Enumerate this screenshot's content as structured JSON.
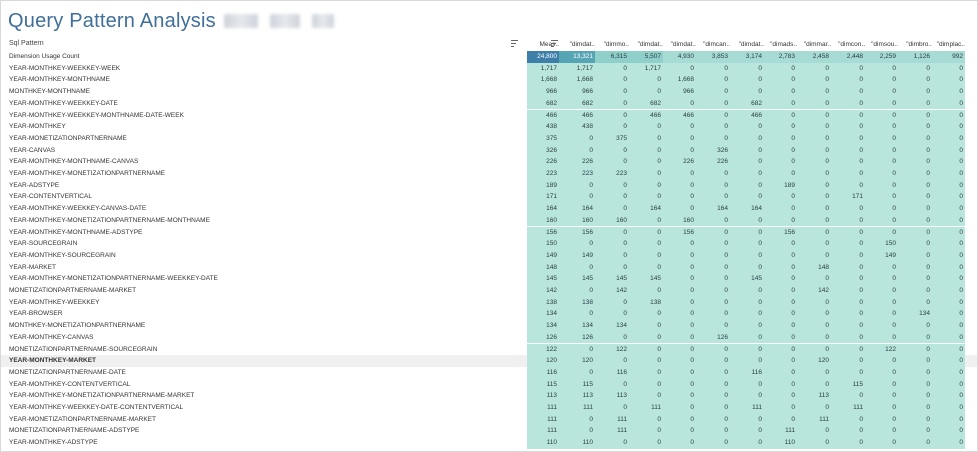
{
  "title": "Query Pattern Analysis",
  "row_header": "Sql Pattern",
  "columns": [
    "Meas..",
    "\"dimdat..",
    "\"dimmo..",
    "\"dimdat..",
    "\"dimdat..",
    "\"dimcan..",
    "\"dimdat..",
    "\"dimads..",
    "\"dimmar..",
    "\"dimcon..",
    "\"dimsou..",
    "\"dimbro..",
    "\"dimplac.."
  ],
  "colors": {
    "title": "#3f6f9a",
    "cell_base": "#b8e6dd",
    "cell_top_dark": "#3d7fa8",
    "cell_top_mid": "#56a5b5"
  },
  "rows": [
    {
      "label": "Dimension Usage Count",
      "values": [
        "24,800",
        "13,321",
        "6,315",
        "5,507",
        "4,930",
        "3,853",
        "3,174",
        "2,783",
        "2,458",
        "2,448",
        "2,259",
        "1,126",
        "992"
      ]
    },
    {
      "label": "YEAR-MONTHKEY-WEEKKEY-WEEK",
      "values": [
        "1,717",
        "1,717",
        "0",
        "1,717",
        "0",
        "0",
        "0",
        "0",
        "0",
        "0",
        "0",
        "0",
        "0"
      ]
    },
    {
      "label": "YEAR-MONTHKEY-MONTHNAME",
      "values": [
        "1,668",
        "1,668",
        "0",
        "0",
        "1,668",
        "0",
        "0",
        "0",
        "0",
        "0",
        "0",
        "0",
        "0"
      ]
    },
    {
      "label": "MONTHKEY-MONTHNAME",
      "values": [
        "966",
        "966",
        "0",
        "0",
        "966",
        "0",
        "0",
        "0",
        "0",
        "0",
        "0",
        "0",
        "0"
      ]
    },
    {
      "label": "YEAR-MONTHKEY-WEEKKEY-DATE",
      "values": [
        "682",
        "682",
        "0",
        "682",
        "0",
        "0",
        "682",
        "0",
        "0",
        "0",
        "0",
        "0",
        "0"
      ]
    },
    {
      "label": "YEAR-MONTHKEY-WEEKKEY-MONTHNAME-DATE-WEEK",
      "values": [
        "466",
        "466",
        "0",
        "466",
        "466",
        "0",
        "466",
        "0",
        "0",
        "0",
        "0",
        "0",
        "0"
      ]
    },
    {
      "label": "YEAR-MONTHKEY",
      "values": [
        "438",
        "438",
        "0",
        "0",
        "0",
        "0",
        "0",
        "0",
        "0",
        "0",
        "0",
        "0",
        "0"
      ]
    },
    {
      "label": "YEAR-MONETIZATIONPARTNERNAME",
      "values": [
        "375",
        "0",
        "375",
        "0",
        "0",
        "0",
        "0",
        "0",
        "0",
        "0",
        "0",
        "0",
        "0"
      ]
    },
    {
      "label": "YEAR-CANVAS",
      "values": [
        "326",
        "0",
        "0",
        "0",
        "0",
        "326",
        "0",
        "0",
        "0",
        "0",
        "0",
        "0",
        "0"
      ]
    },
    {
      "label": "YEAR-MONTHKEY-MONTHNAME-CANVAS",
      "values": [
        "226",
        "226",
        "0",
        "0",
        "226",
        "226",
        "0",
        "0",
        "0",
        "0",
        "0",
        "0",
        "0"
      ]
    },
    {
      "label": "YEAR-MONTHKEY-MONETIZATIONPARTNERNAME",
      "values": [
        "223",
        "223",
        "223",
        "0",
        "0",
        "0",
        "0",
        "0",
        "0",
        "0",
        "0",
        "0",
        "0"
      ]
    },
    {
      "label": "YEAR-ADSTYPE",
      "values": [
        "189",
        "0",
        "0",
        "0",
        "0",
        "0",
        "0",
        "189",
        "0",
        "0",
        "0",
        "0",
        "0"
      ]
    },
    {
      "label": "YEAR-CONTENTVERTICAL",
      "values": [
        "171",
        "0",
        "0",
        "0",
        "0",
        "0",
        "0",
        "0",
        "0",
        "171",
        "0",
        "0",
        "0"
      ]
    },
    {
      "label": "YEAR-MONTHKEY-WEEKKEY-CANVAS-DATE",
      "values": [
        "164",
        "164",
        "0",
        "164",
        "0",
        "164",
        "164",
        "0",
        "0",
        "0",
        "0",
        "0",
        "0"
      ]
    },
    {
      "label": "YEAR-MONTHKEY-MONETIZATIONPARTNERNAME-MONTHNAME",
      "values": [
        "160",
        "160",
        "160",
        "0",
        "160",
        "0",
        "0",
        "0",
        "0",
        "0",
        "0",
        "0",
        "0"
      ]
    },
    {
      "label": "YEAR-MONTHKEY-MONTHNAME-ADSTYPE",
      "values": [
        "156",
        "156",
        "0",
        "0",
        "156",
        "0",
        "0",
        "156",
        "0",
        "0",
        "0",
        "0",
        "0"
      ]
    },
    {
      "label": "YEAR-SOURCEGRAIN",
      "values": [
        "150",
        "0",
        "0",
        "0",
        "0",
        "0",
        "0",
        "0",
        "0",
        "0",
        "150",
        "0",
        "0"
      ]
    },
    {
      "label": "YEAR-MONTHKEY-SOURCEGRAIN",
      "values": [
        "149",
        "149",
        "0",
        "0",
        "0",
        "0",
        "0",
        "0",
        "0",
        "0",
        "149",
        "0",
        "0"
      ]
    },
    {
      "label": "YEAR-MARKET",
      "values": [
        "148",
        "0",
        "0",
        "0",
        "0",
        "0",
        "0",
        "0",
        "148",
        "0",
        "0",
        "0",
        "0"
      ]
    },
    {
      "label": "YEAR-MONTHKEY-MONETIZATIONPARTNERNAME-WEEKKEY-DATE",
      "values": [
        "145",
        "145",
        "145",
        "145",
        "0",
        "0",
        "145",
        "0",
        "0",
        "0",
        "0",
        "0",
        "0"
      ]
    },
    {
      "label": "MONETIZATIONPARTNERNAME-MARKET",
      "values": [
        "142",
        "0",
        "142",
        "0",
        "0",
        "0",
        "0",
        "0",
        "142",
        "0",
        "0",
        "0",
        "0"
      ]
    },
    {
      "label": "YEAR-MONTHKEY-WEEKKEY",
      "values": [
        "138",
        "138",
        "0",
        "138",
        "0",
        "0",
        "0",
        "0",
        "0",
        "0",
        "0",
        "0",
        "0"
      ]
    },
    {
      "label": "YEAR-BROWSER",
      "values": [
        "134",
        "0",
        "0",
        "0",
        "0",
        "0",
        "0",
        "0",
        "0",
        "0",
        "0",
        "134",
        "0"
      ]
    },
    {
      "label": "MONTHKEY-MONETIZATIONPARTNERNAME",
      "values": [
        "134",
        "134",
        "134",
        "0",
        "0",
        "0",
        "0",
        "0",
        "0",
        "0",
        "0",
        "0",
        "0"
      ]
    },
    {
      "label": "YEAR-MONTHKEY-CANVAS",
      "values": [
        "126",
        "126",
        "0",
        "0",
        "0",
        "126",
        "0",
        "0",
        "0",
        "0",
        "0",
        "0",
        "0"
      ]
    },
    {
      "label": "MONETIZATIONPARTNERNAME-SOURCEGRAIN",
      "values": [
        "122",
        "0",
        "122",
        "0",
        "0",
        "0",
        "0",
        "0",
        "0",
        "0",
        "122",
        "0",
        "0"
      ]
    },
    {
      "label": "YEAR-MONTHKEY-MARKET",
      "values": [
        "120",
        "120",
        "0",
        "0",
        "0",
        "0",
        "0",
        "0",
        "120",
        "0",
        "0",
        "0",
        "0"
      ]
    },
    {
      "label": "MONETIZATIONPARTNERNAME-DATE",
      "values": [
        "116",
        "0",
        "116",
        "0",
        "0",
        "0",
        "116",
        "0",
        "0",
        "0",
        "0",
        "0",
        "0"
      ]
    },
    {
      "label": "YEAR-MONTHKEY-CONTENTVERTICAL",
      "values": [
        "115",
        "115",
        "0",
        "0",
        "0",
        "0",
        "0",
        "0",
        "0",
        "115",
        "0",
        "0",
        "0"
      ]
    },
    {
      "label": "YEAR-MONTHKEY-MONETIZATIONPARTNERNAME-MARKET",
      "values": [
        "113",
        "113",
        "113",
        "0",
        "0",
        "0",
        "0",
        "0",
        "113",
        "0",
        "0",
        "0",
        "0"
      ]
    },
    {
      "label": "YEAR-MONTHKEY-WEEKKEY-DATE-CONTENTVERTICAL",
      "values": [
        "111",
        "111",
        "0",
        "111",
        "0",
        "0",
        "111",
        "0",
        "0",
        "111",
        "0",
        "0",
        "0"
      ]
    },
    {
      "label": "YEAR-MONETIZATIONPARTNERNAME-MARKET",
      "values": [
        "111",
        "0",
        "111",
        "0",
        "0",
        "0",
        "0",
        "0",
        "111",
        "0",
        "0",
        "0",
        "0"
      ]
    },
    {
      "label": "MONETIZATIONPARTNERNAME-ADSTYPE",
      "values": [
        "111",
        "0",
        "111",
        "0",
        "0",
        "0",
        "0",
        "111",
        "0",
        "0",
        "0",
        "0",
        "0"
      ]
    },
    {
      "label": "YEAR-MONTHKEY-ADSTYPE",
      "values": [
        "110",
        "110",
        "0",
        "0",
        "0",
        "0",
        "0",
        "110",
        "0",
        "0",
        "0",
        "0",
        "0"
      ]
    }
  ],
  "highlighted_row_index": 26
}
